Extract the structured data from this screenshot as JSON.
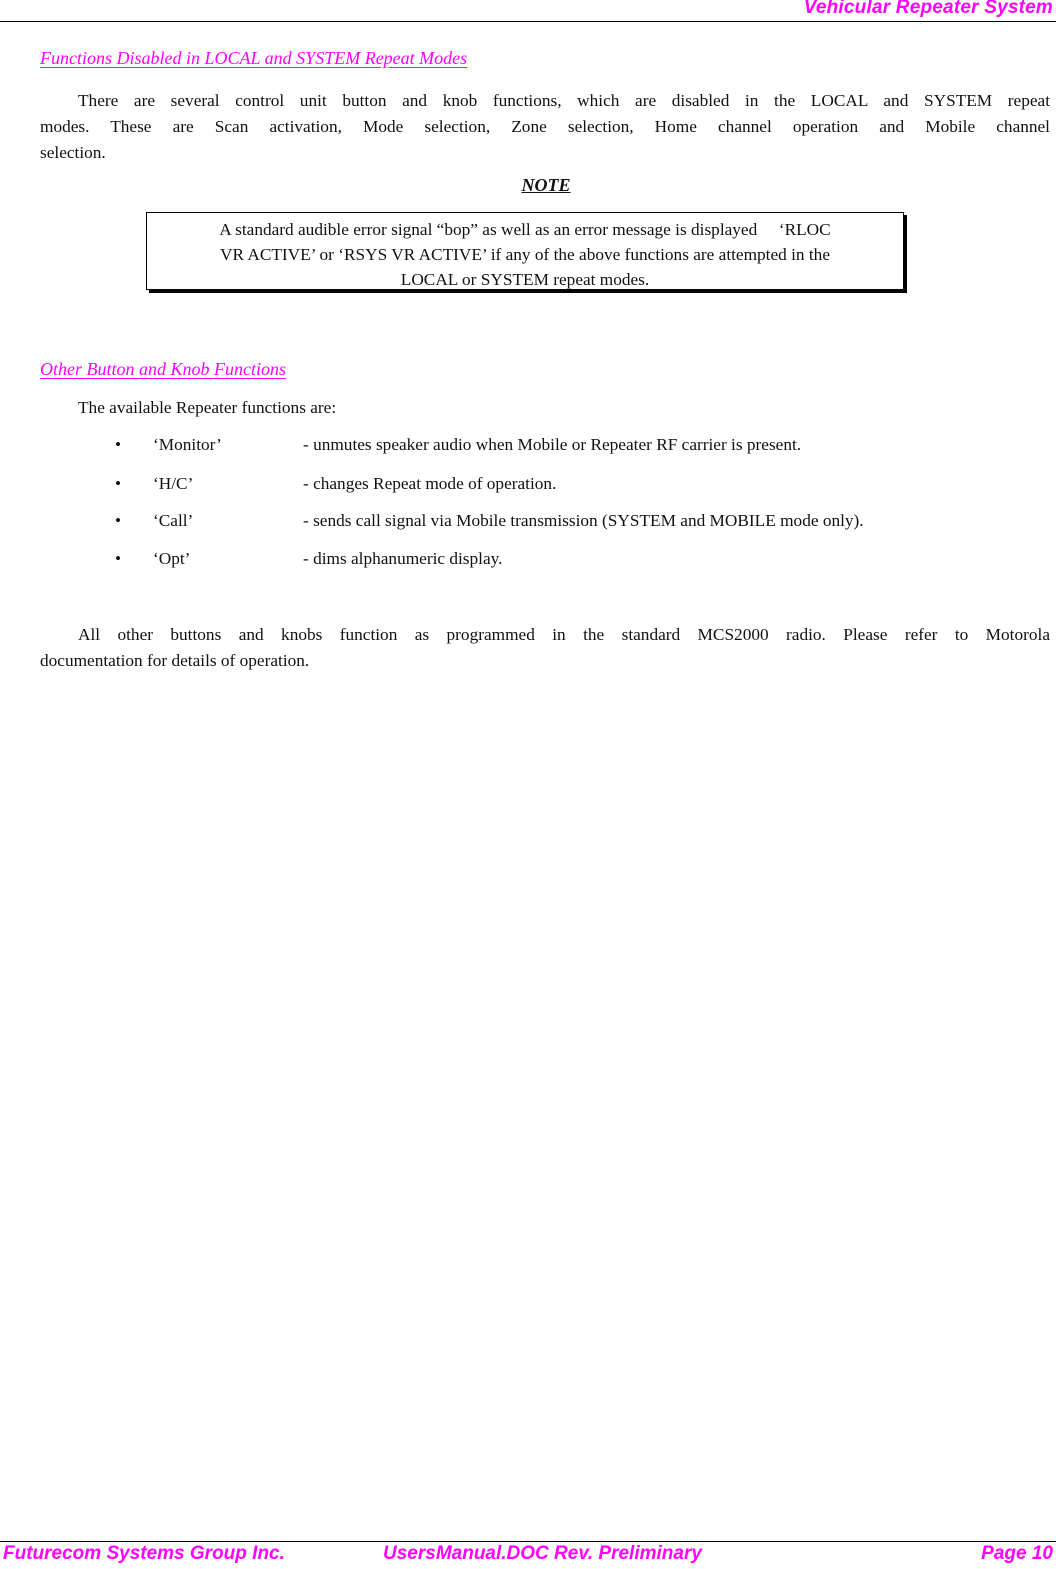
{
  "header": {
    "title": "Vehicular Repeater System"
  },
  "section1": {
    "heading": "Functions Disabled in LOCAL and SYSTEM Repeat Modes",
    "paragraph_line1": "There are several control unit button and knob functions, which are disabled in the LOCAL and SYSTEM repeat",
    "paragraph_line2": "modes.  These are Scan activation, Mode selection, Zone selection, Home channel operation and Mobile channel",
    "paragraph_line3": "selection.",
    "note_label": "NOTE",
    "note_line1": "A standard audible error signal “bop” as well as an error message is displayed     ‘RLOC",
    "note_line2": "VR ACTIVE’ or ‘RSYS VR ACTIVE’ if any of the above functions are attempted in the",
    "note_line3": "LOCAL or SYSTEM repeat modes."
  },
  "section2": {
    "heading": "Other Button and Knob Functions",
    "intro": "The available Repeater functions are:",
    "bullet_glyph": "•",
    "items": [
      {
        "key": "‘Monitor’",
        "desc": "- unmutes speaker audio when Mobile or Repeater RF carrier is present."
      },
      {
        "key": "‘H/C’",
        "desc": "- changes Repeat mode of operation."
      },
      {
        "key": "‘Call’",
        "desc": "- sends call signal via Mobile transmission (SYSTEM and MOBILE mode only)."
      },
      {
        "key": "‘Opt’",
        "desc": "- dims alphanumeric display."
      }
    ],
    "closing_line1": "All other buttons and knobs function as programmed in the standard MCS2000 radio. Please refer to Motorola",
    "closing_line2": "documentation for details of operation."
  },
  "footer": {
    "company": "Futurecom Systems Group Inc.",
    "document": "UsersManual.DOC Rev. Preliminary",
    "page": "Page 10"
  },
  "colors": {
    "accent": "#ff00ff",
    "text": "#111111"
  }
}
